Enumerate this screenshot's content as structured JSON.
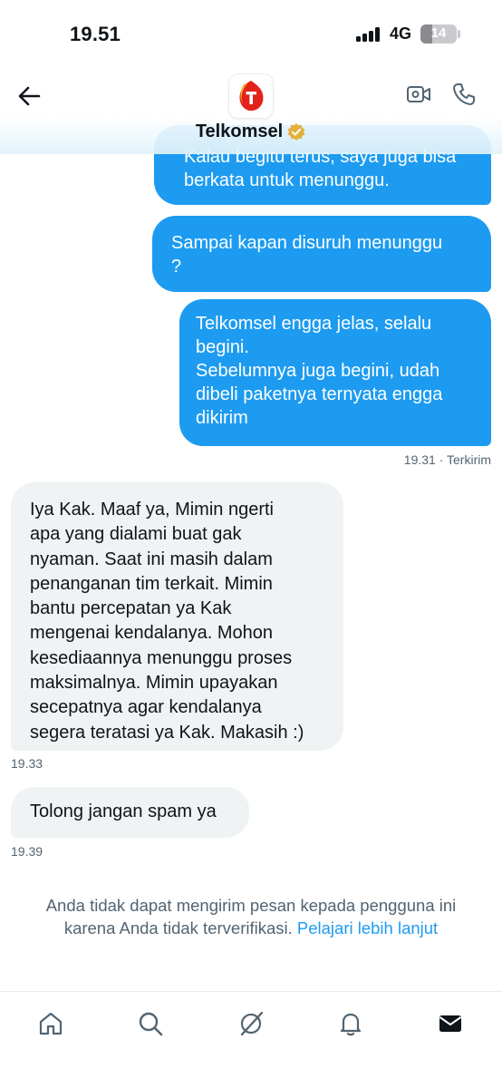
{
  "status_bar": {
    "time": "19.51",
    "network": "4G",
    "battery": "14"
  },
  "header": {
    "title": "Telkomsel",
    "back_icon": "arrow-left-icon",
    "video_icon": "video-camera-icon",
    "call_icon": "phone-icon",
    "verified_icon": "verified-gold-badge-icon"
  },
  "messages": [
    {
      "direction": "sent",
      "text": "Kalau begitu terus, saya juga bisa\nberkata untuk menunggu."
    },
    {
      "direction": "sent",
      "text": "Sampai kapan disuruh menunggu\n?"
    },
    {
      "direction": "sent",
      "text": "Telkomsel engga jelas, selalu\nbegini.\nSebelumnya juga begini, udah\ndibeli paketnya ternyata engga\ndikirim"
    },
    {
      "direction": "received",
      "text": "Iya Kak. Maaf ya, Mimin ngerti\napa yang dialami buat gak\nnyaman. Saat ini masih dalam\npenanganan tim terkait. Mimin\nbantu percepatan ya Kak\nmengenai kendalanya. Mohon\nkesediaannya menunggu proses\nmaksimalnya. Mimin upayakan\nsecepatnya agar kendalanya\nsegera teratasi ya Kak. Makasih :)"
    },
    {
      "direction": "received",
      "text": "Tolong jangan spam ya"
    }
  ],
  "meta": {
    "sent_status": "19.31 · Terkirim",
    "recv_time_1": "19.33",
    "recv_time_2": "19.39"
  },
  "notice": {
    "line1": "Anda tidak dapat mengirim pesan kepada pengguna ini",
    "line2": "karena Anda tidak terverifikasi.",
    "link": "Pelajari lebih lanjut"
  },
  "bottom_nav": [
    {
      "icon": "home-icon"
    },
    {
      "icon": "search-icon"
    },
    {
      "icon": "grok-icon"
    },
    {
      "icon": "bell-icon"
    },
    {
      "icon": "mail-icon",
      "active": true
    }
  ],
  "colors": {
    "accent": "#1d9bf0",
    "sent_bubble": "#1d9bf0",
    "received_bubble": "#eff3f4",
    "secondary_text": "#536471",
    "brand_red": "#e2231a"
  }
}
